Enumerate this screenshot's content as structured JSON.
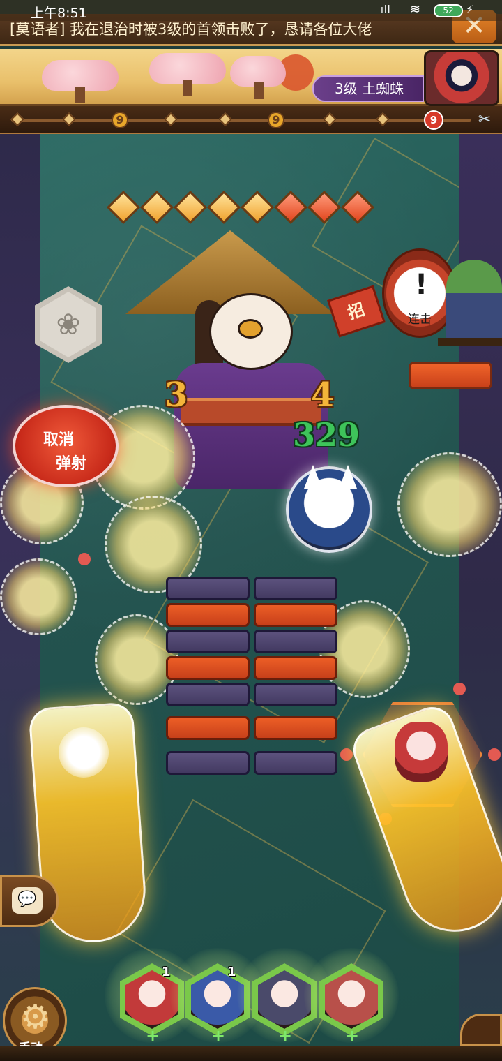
{
  "status_bar": {
    "time": "上午8:51",
    "signal": "ıll",
    "wifi": "≋",
    "battery": "52",
    "charging": "⚡"
  },
  "news": {
    "text": "[莫语者] 我在退治时被3级的首领击败了，恳请各位大佬",
    "close": "✕"
  },
  "boss": {
    "label": "3级 土蜘蛛"
  },
  "progress": {
    "markers": [
      "9",
      "9"
    ],
    "boss_marker": "9",
    "end_icon": "✂"
  },
  "field": {
    "hp_diamonds": [
      "gold",
      "gold",
      "gold",
      "gold",
      "gold",
      "red",
      "red",
      "red"
    ],
    "damage_3": "3",
    "damage_4": "4",
    "damage_329": "329",
    "stamp_icon": "❀",
    "cancel_line1": "取消",
    "cancel_line2": "弹射",
    "combo_mark": "!",
    "combo_label": "连击",
    "combo_tag": "招"
  },
  "bottom": {
    "chat_icon": "💬",
    "gear_icon": "⚙",
    "auto_label": "手动",
    "team": [
      {
        "name": "shikigami-1",
        "count": "1",
        "plus": "+",
        "color": "#c23a3a"
      },
      {
        "name": "shikigami-2",
        "count": "1",
        "plus": "+",
        "color": "#3a5aa8"
      },
      {
        "name": "shikigami-3",
        "count": "",
        "plus": "+",
        "color": "#4a4a6a"
      },
      {
        "name": "shikigami-4",
        "count": "",
        "plus": "+",
        "color": "#b8504a"
      }
    ]
  },
  "colors": {
    "accent_gold": "#f3b43a",
    "damage_green": "#3ec45a",
    "block_orange": "#ec5e26",
    "block_purple": "#5c527e"
  }
}
